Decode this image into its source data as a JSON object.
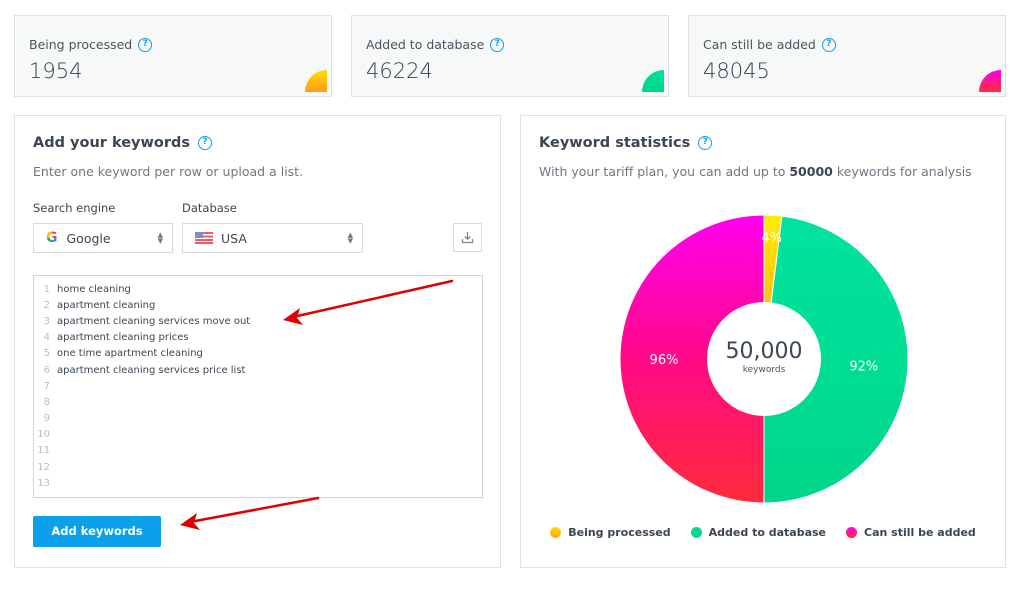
{
  "stats": [
    {
      "label": "Being processed",
      "value": "1954",
      "color_from": "#ffde00",
      "color_to": "#ff9a1f"
    },
    {
      "label": "Added to database",
      "value": "46224",
      "color_from": "#00e0a0",
      "color_to": "#00d68a"
    },
    {
      "label": "Can still be added",
      "value": "48045",
      "color_from": "#ff00e6",
      "color_to": "#ff2d3c"
    }
  ],
  "add_panel": {
    "title": "Add your keywords",
    "subtitle": "Enter one keyword per row or upload a list.",
    "search_engine_label": "Search engine",
    "search_engine_value": "Google",
    "database_label": "Database",
    "database_value": "USA",
    "upload_icon": "download-tray-icon",
    "lines": [
      {
        "n": "1",
        "text": "home cleaning"
      },
      {
        "n": "2",
        "text": "apartment cleaning"
      },
      {
        "n": "3",
        "text": "apartment cleaning services move out"
      },
      {
        "n": "4",
        "text": "apartment cleaning prices"
      },
      {
        "n": "5",
        "text": "one time apartment cleaning"
      },
      {
        "n": "6",
        "text": "apartment cleaning services price list"
      },
      {
        "n": "7",
        "text": ""
      },
      {
        "n": "8",
        "text": ""
      },
      {
        "n": "9",
        "text": ""
      },
      {
        "n": "10",
        "text": ""
      },
      {
        "n": "11",
        "text": ""
      },
      {
        "n": "12",
        "text": ""
      },
      {
        "n": "13",
        "text": ""
      }
    ],
    "add_button": "Add keywords"
  },
  "stats_panel": {
    "title": "Keyword statistics",
    "subtitle_pre": "With your tariff plan, you can add up to ",
    "subtitle_bold": "50000",
    "subtitle_post": " keywords for analysis",
    "center_value": "50,000",
    "center_label": "keywords"
  },
  "chart_data": {
    "type": "pie",
    "title": "Keyword statistics",
    "total": 50000,
    "categories": [
      "Being processed",
      "Added to database",
      "Can still be added"
    ],
    "values": [
      1954,
      46224,
      48045
    ],
    "slice_fractions": [
      0.02,
      0.48,
      0.5
    ],
    "data_labels": [
      "4%",
      "92%",
      "96%"
    ],
    "colors": [
      "#ffc21a",
      "#00dc96",
      "#ff0a8c"
    ],
    "legend_position": "bottom"
  }
}
